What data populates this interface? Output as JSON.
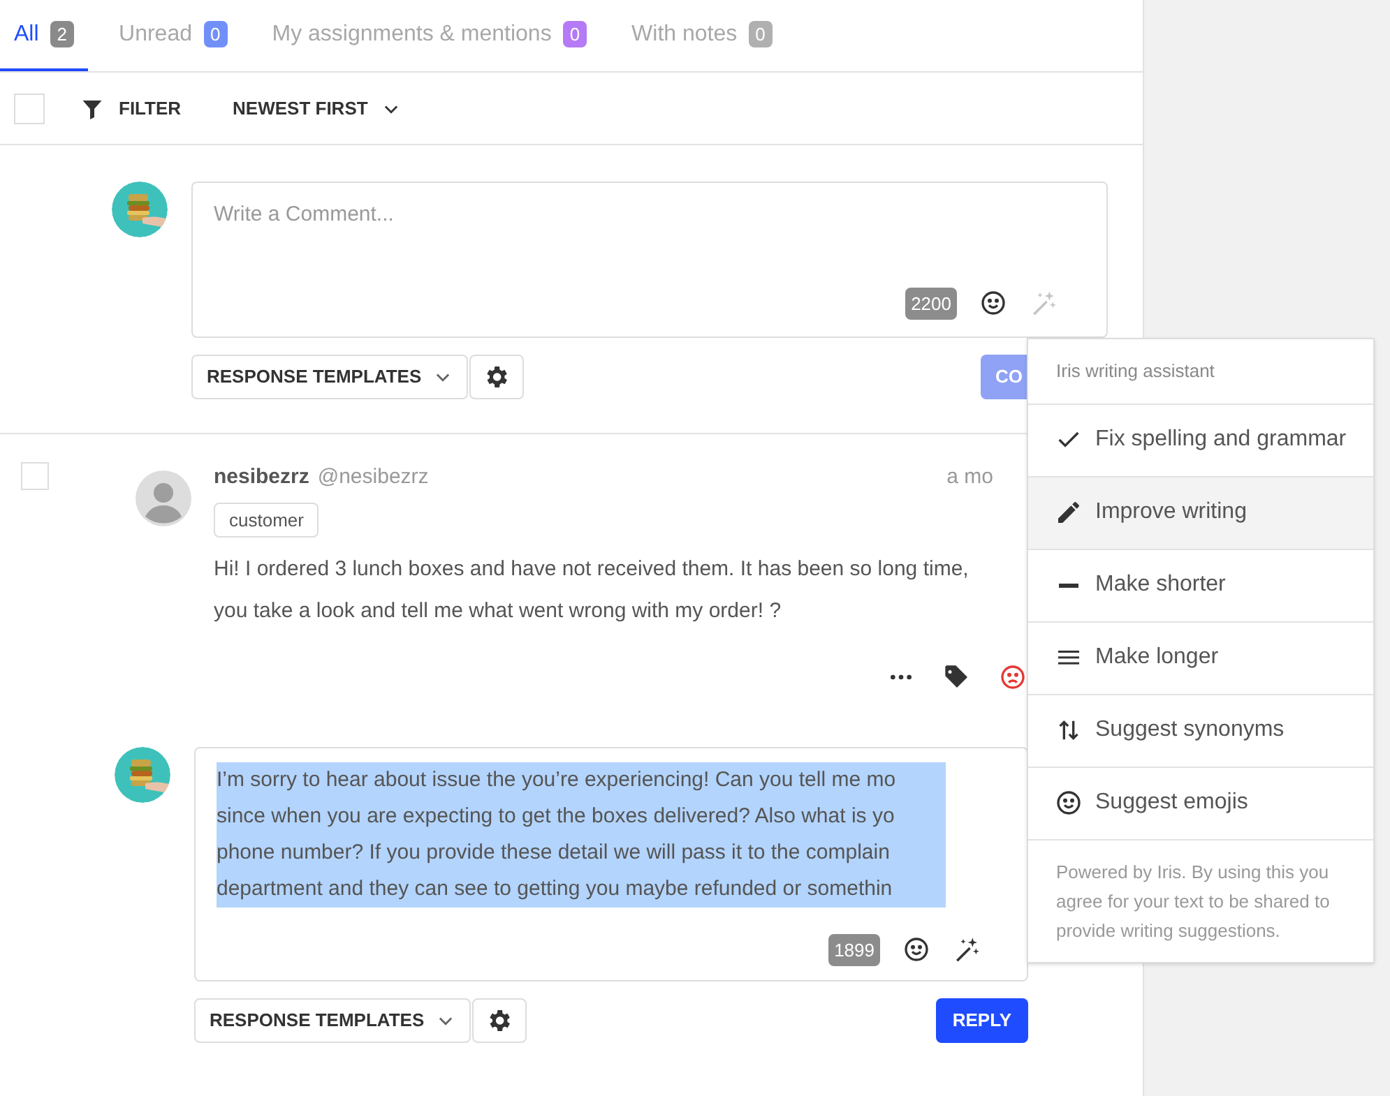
{
  "tabs": [
    {
      "label": "All",
      "count": "2",
      "selected": true,
      "color": "#8a8a8a"
    },
    {
      "label": "Unread",
      "count": "0",
      "selected": false,
      "color": "#7190f7"
    },
    {
      "label": "My assignments & mentions",
      "count": "0",
      "selected": false,
      "color": "#b57af5"
    },
    {
      "label": "With notes",
      "count": "0",
      "selected": false,
      "color": "#b0b0b0"
    }
  ],
  "toolbar": {
    "select_all_checked": false,
    "filter": "FILTER",
    "sort": "NEWEST FIRST"
  },
  "composer": {
    "placeholder": "Write a Comment...",
    "counter": "2200",
    "assistant_active": false,
    "templates": "RESPONSE TEMPLATES",
    "submit": "CO",
    "submit_disabled": true
  },
  "message": {
    "checked": false,
    "author": "nesibezrz",
    "handle": "@nesibezrz",
    "time": "a mo",
    "tag": "customer",
    "lines": [
      "Hi! I ordered 3 lunch boxes and have not received them. It has been so long time,",
      "you take a look and tell me what went wrong with my order! ?"
    ]
  },
  "reply": {
    "lines": [
      "I’m sorry to hear about issue the you’re experiencing! Can you tell me mo",
      "since when you are expecting to get the boxes delivered? Also what is yo",
      "phone number? If you provide these detail we will pass it to the complain",
      "department and they can see to getting you maybe refunded or somethin"
    ],
    "text_selected": true,
    "counter": "1899",
    "assistant_active": true,
    "templates": "RESPONSE TEMPLATES",
    "submit": "REPLY",
    "submit_disabled": false
  },
  "assistant_menu": {
    "title": "Iris writing assistant",
    "items": [
      {
        "label": "Fix spelling and grammar",
        "kind": "check",
        "selected": false
      },
      {
        "label": "Improve writing",
        "kind": "pencil",
        "selected": true
      },
      {
        "label": "Make shorter",
        "kind": "minus",
        "selected": false
      },
      {
        "label": "Make longer",
        "kind": "lines",
        "selected": false
      },
      {
        "label": "Suggest synonyms",
        "kind": "swap",
        "selected": false
      },
      {
        "label": "Suggest emojis",
        "kind": "smiley",
        "selected": false
      }
    ],
    "footer": "Powered by Iris. By using this you agree for your text to be shared to provide writing suggestions."
  }
}
